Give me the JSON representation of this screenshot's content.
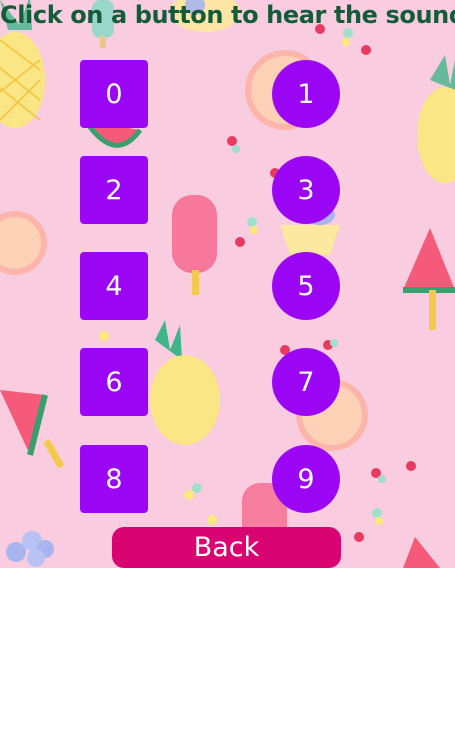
{
  "page": {
    "instruction": "Click on a button to hear the sound",
    "background_color": "#f9cce0",
    "instruction_color": "#145c39"
  },
  "buttons": [
    {
      "label": "0",
      "shape": "square"
    },
    {
      "label": "1",
      "shape": "circle"
    },
    {
      "label": "2",
      "shape": "square"
    },
    {
      "label": "3",
      "shape": "circle"
    },
    {
      "label": "4",
      "shape": "square"
    },
    {
      "label": "5",
      "shape": "circle"
    },
    {
      "label": "6",
      "shape": "square"
    },
    {
      "label": "7",
      "shape": "circle"
    },
    {
      "label": "8",
      "shape": "square"
    },
    {
      "label": "9",
      "shape": "circle"
    }
  ],
  "button_color": "#9b07f5",
  "back": {
    "label": "Back",
    "color": "#d90471"
  }
}
